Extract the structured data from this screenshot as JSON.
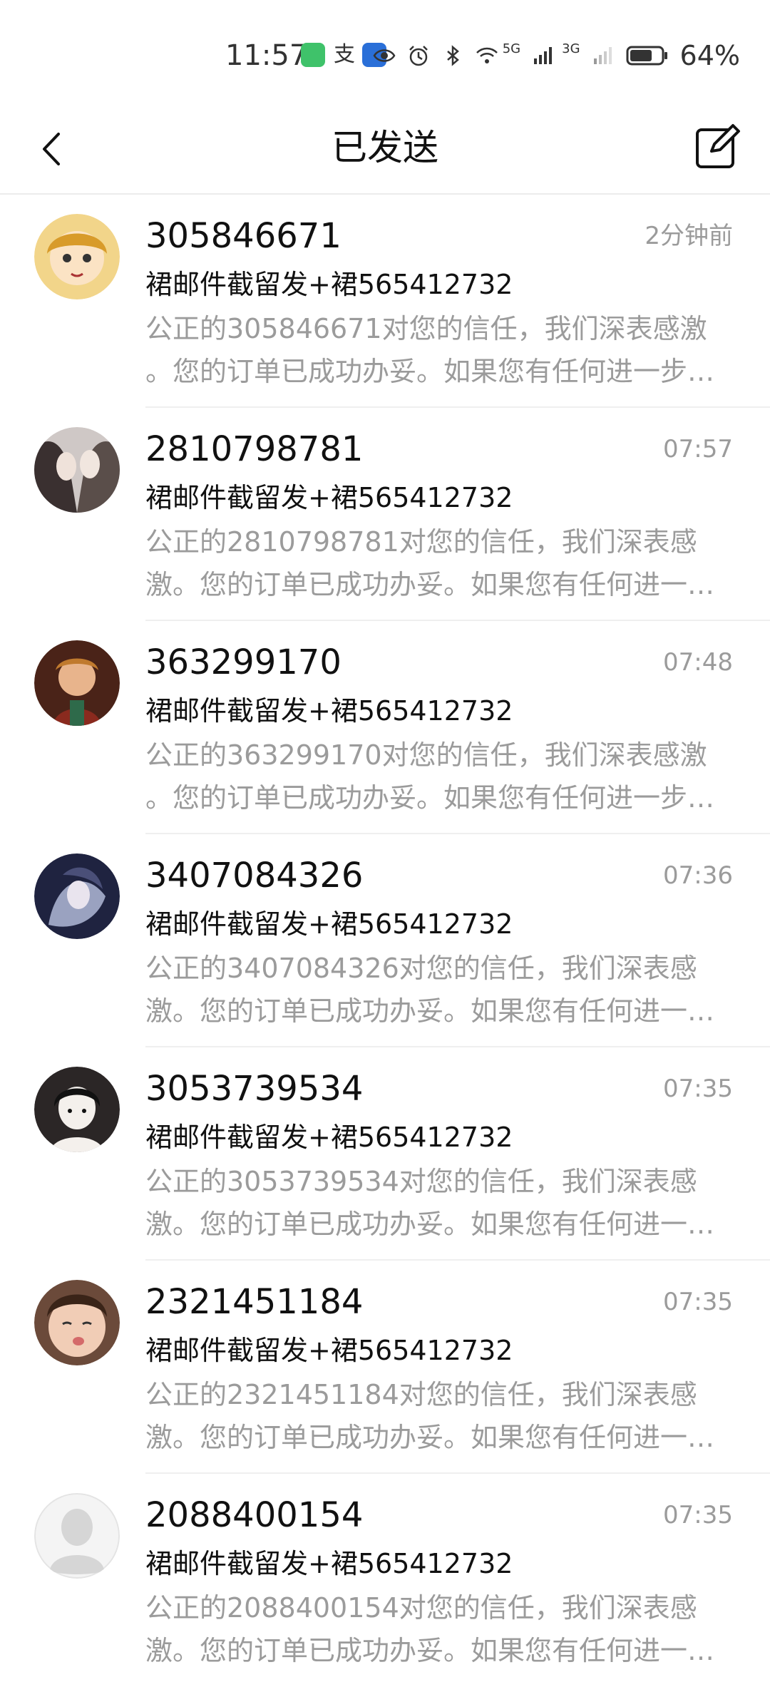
{
  "status_bar": {
    "time": "11:57",
    "battery": "64%",
    "net1": "5G",
    "net2": "3G"
  },
  "header": {
    "title": "已发送"
  },
  "messages": [
    {
      "number": "305846671",
      "time": "2分钟前",
      "sender": "裙邮件截留发+裙565412732",
      "preview_line1": "公正的305846671对您的信任，我们深表感激",
      "preview_line2": "。您的订单已成功办妥。如果您有任何进一步…",
      "avatar_color": "#d89b2a"
    },
    {
      "number": "2810798781",
      "time": "07:57",
      "sender": "裙邮件截留发+裙565412732",
      "preview_line1": "公正的2810798781对您的信任，我们深表感",
      "preview_line2": "激。您的订单已成功办妥。如果您有任何进一…",
      "avatar_color": "#6f6a70"
    },
    {
      "number": "363299170",
      "time": "07:48",
      "sender": "裙邮件截留发+裙565412732",
      "preview_line1": "公正的363299170对您的信任，我们深表感激",
      "preview_line2": "。您的订单已成功办妥。如果您有任何进一步…",
      "avatar_color": "#7a3a22"
    },
    {
      "number": "3407084326",
      "time": "07:36",
      "sender": "裙邮件截留发+裙565412732",
      "preview_line1": "公正的3407084326对您的信任，我们深表感",
      "preview_line2": "激。您的订单已成功办妥。如果您有任何进一…",
      "avatar_color": "#3a3f63"
    },
    {
      "number": "3053739534",
      "time": "07:35",
      "sender": "裙邮件截留发+裙565412732",
      "preview_line1": "公正的3053739534对您的信任，我们深表感",
      "preview_line2": "激。您的订单已成功办妥。如果您有任何进一…",
      "avatar_color": "#2b2b2b"
    },
    {
      "number": "2321451184",
      "time": "07:35",
      "sender": "裙邮件截留发+裙565412732",
      "preview_line1": "公正的2321451184对您的信任，我们深表感",
      "preview_line2": "激。您的订单已成功办妥。如果您有任何进一…",
      "avatar_color": "#c79a84"
    },
    {
      "number": "2088400154",
      "time": "07:35",
      "sender": "裙邮件截留发+裙565412732",
      "preview_line1": "公正的2088400154对您的信任，我们深表感",
      "preview_line2": "激。您的订单已成功办妥。如果您有任何进一…",
      "avatar_color": "#e6e6e6"
    }
  ]
}
